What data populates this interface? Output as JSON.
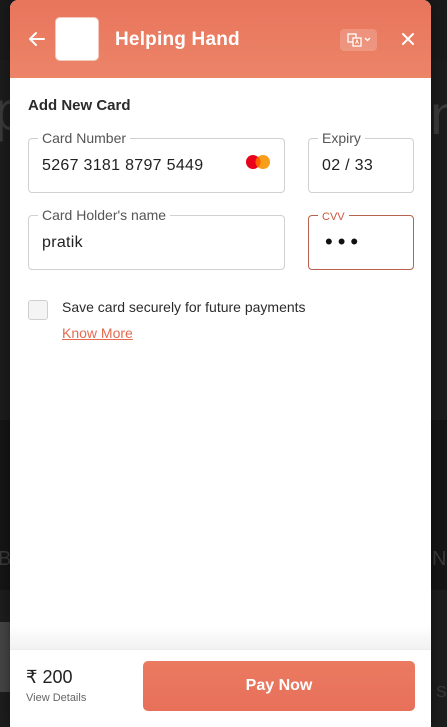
{
  "header": {
    "title": "Helping Hand",
    "back_icon": "arrow-left-icon",
    "language_icon": "translate-icon",
    "close_icon": "close-icon",
    "brand_color": "#e8755c"
  },
  "form": {
    "section_title": "Add New Card",
    "card_number": {
      "label": "Card Number",
      "value": "5267 3181 8797 5449",
      "network_icon": "mastercard-icon"
    },
    "expiry": {
      "label": "Expiry",
      "value": "02 / 33"
    },
    "holder": {
      "label": "Card Holder's name",
      "value": "pratik"
    },
    "cvv": {
      "label": "CVV",
      "value": "•••"
    },
    "save_card": {
      "label": "Save card securely for future payments",
      "checked": false
    },
    "know_more": "Know More"
  },
  "footer": {
    "amount": "₹ 200",
    "view_details": "View Details",
    "pay_button": "Pay Now"
  },
  "background": {
    "glyph_left": "p",
    "glyph_right": "n",
    "text_left": "BL",
    "text_right": "N",
    "text_bottom_right": "S"
  }
}
